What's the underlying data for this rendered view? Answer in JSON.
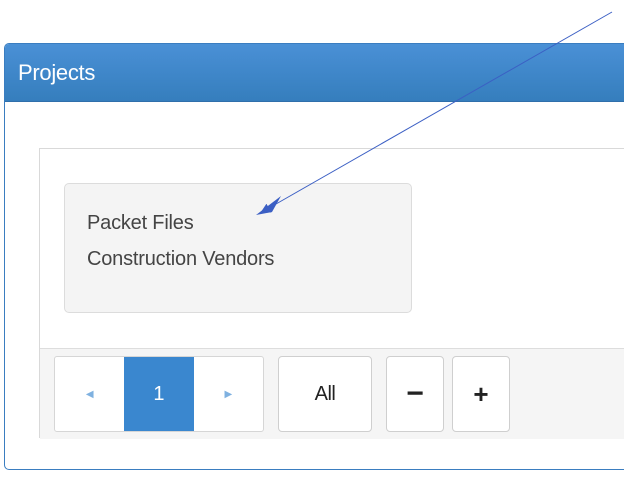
{
  "panel": {
    "title": "Projects"
  },
  "projects": [
    {
      "label": "Packet Files"
    },
    {
      "label": "Construction Vendors"
    }
  ],
  "pagination": {
    "prev_icon": "triangle-left-icon",
    "current_page": "1",
    "next_icon": "triangle-right-icon"
  },
  "toolbar": {
    "all_label": "All",
    "minus_label": "−",
    "plus_label": "+"
  },
  "colors": {
    "header": "#357ebd",
    "active_page": "#3a87cf",
    "annotation_arrow": "#3b5fc4"
  }
}
